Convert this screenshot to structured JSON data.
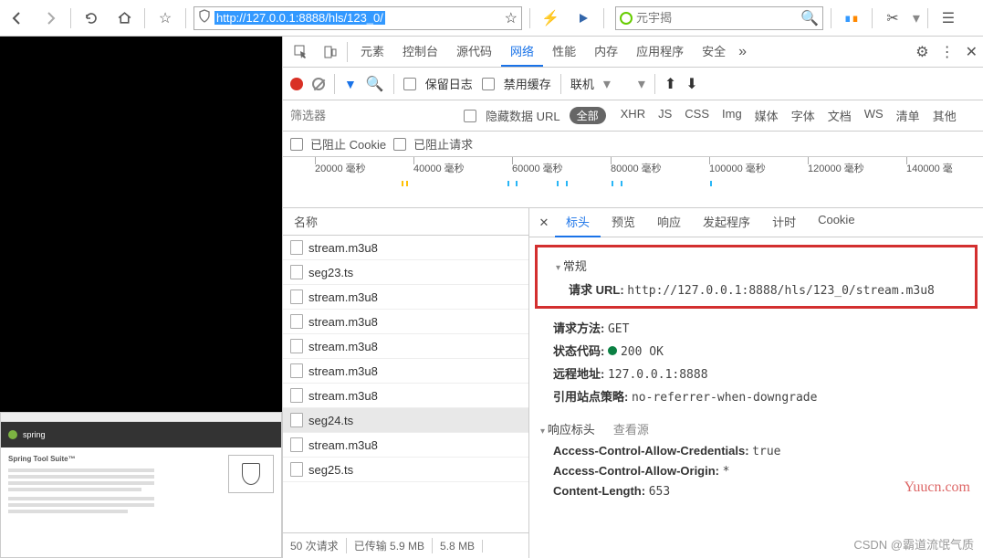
{
  "toolbar": {
    "url": "http://127.0.0.1:8888/hls/123_0/",
    "search_ph": "元宇揭"
  },
  "devtabs": [
    "元素",
    "控制台",
    "源代码",
    "网络",
    "性能",
    "内存",
    "应用程序",
    "安全"
  ],
  "devtabs_active": 3,
  "bar": {
    "preserve": "保留日志",
    "disable_cache": "禁用缓存",
    "throttle": "联机"
  },
  "filter": {
    "ph": "筛选器",
    "hide": "隐藏数据 URL",
    "all": "全部",
    "types": [
      "XHR",
      "JS",
      "CSS",
      "Img",
      "媒体",
      "字体",
      "文档",
      "WS",
      "清单",
      "其他"
    ]
  },
  "cookie": {
    "blocked": "已阻止 Cookie",
    "blocked_req": "已阻止请求"
  },
  "timeline": [
    "20000 毫秒",
    "40000 毫秒",
    "60000 毫秒",
    "80000 毫秒",
    "100000 毫秒",
    "120000 毫秒",
    "140000 毫"
  ],
  "name_hdr": "名称",
  "requests": [
    "stream.m3u8",
    "seg23.ts",
    "stream.m3u8",
    "stream.m3u8",
    "stream.m3u8",
    "stream.m3u8",
    "stream.m3u8",
    "seg24.ts",
    "stream.m3u8",
    "seg25.ts"
  ],
  "footer": {
    "count": "50 次请求",
    "transferred": "已传输 5.9 MB",
    "size": "5.8 MB"
  },
  "dtabs": [
    "标头",
    "预览",
    "响应",
    "发起程序",
    "计时",
    "Cookie"
  ],
  "dtabs_active": 0,
  "general": {
    "title": "常规",
    "url_k": "请求 URL:",
    "url_v": "http://127.0.0.1:8888/hls/123_0/stream.m3u8",
    "method_k": "请求方法:",
    "method_v": "GET",
    "status_k": "状态代码:",
    "status_v": "200 OK",
    "remote_k": "远程地址:",
    "remote_v": "127.0.0.1:8888",
    "ref_k": "引用站点策略:",
    "ref_v": "no-referrer-when-downgrade"
  },
  "resp": {
    "title": "响应标头",
    "src": "查看源",
    "h1_k": "Access-Control-Allow-Credentials:",
    "h1_v": "true",
    "h2_k": "Access-Control-Allow-Origin:",
    "h2_v": "*",
    "h3_k": "Content-Length:",
    "h3_v": "653"
  },
  "thumb": {
    "brand": "spring",
    "title": "Spring Tool Suite™"
  },
  "wm": "CSDN @霸道流氓气质",
  "wm2": "Yuucn.com"
}
